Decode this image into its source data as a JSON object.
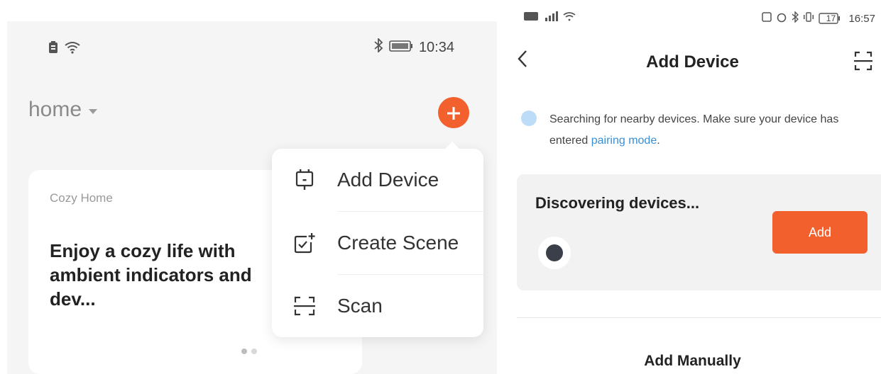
{
  "left": {
    "status_bar": {
      "time": "10:34",
      "icons": [
        "battery-saver-icon",
        "wifi-icon",
        "bluetooth-icon",
        "battery-icon"
      ]
    },
    "home": {
      "title": "home"
    },
    "card": {
      "label": "Cozy Home",
      "text": "Enjoy a cozy life with ambient indicators and dev..."
    },
    "menu": {
      "items": [
        {
          "label": "Add Device",
          "icon": "add-device-icon"
        },
        {
          "label": "Create Scene",
          "icon": "create-scene-icon"
        },
        {
          "label": "Scan",
          "icon": "scan-icon"
        }
      ]
    },
    "colors": {
      "accent": "#f2602e"
    }
  },
  "right": {
    "status_bar": {
      "time": "16:57",
      "battery": "17"
    },
    "nav": {
      "title": "Add Device"
    },
    "searching": {
      "text_before": "Searching for nearby devices. Make sure your device has entered ",
      "link": "pairing mode",
      "text_after": "."
    },
    "discover": {
      "title": "Discovering devices...",
      "add_label": "Add"
    },
    "add_manually": "Add Manually",
    "colors": {
      "accent": "#f2602e",
      "link": "#3a8fd6"
    }
  }
}
